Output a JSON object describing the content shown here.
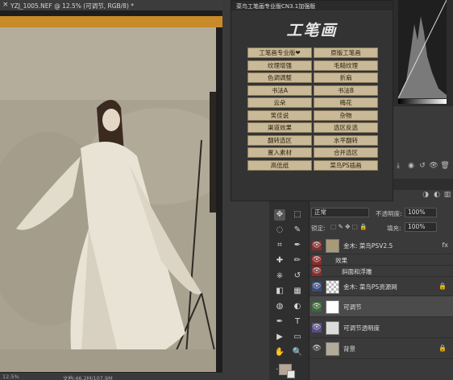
{
  "document": {
    "tab_title": "YZJ_1005.NEF @ 12.5% (可调节, RGB/8) *",
    "close_glyph": "×",
    "status_zoom": "12.5%",
    "status_doc": "文档:46.2M/107.9M"
  },
  "plugin": {
    "title": "菜鸟工笔画专业版CN3.1加强版",
    "logo": "工笔画",
    "buttons": [
      "工笔画专业版❤",
      "原版工笔画",
      "纹理增强",
      "毛糙纹理",
      "色调调整",
      "折扇",
      "书法A",
      "书法B",
      "云朵",
      "梅花",
      "笑佳说",
      "杂物",
      "渠道效果",
      "选区反选",
      "翻转选区",
      "水平翻转",
      "置入素材",
      "合并选区",
      "高低纸",
      "菜鸟PS插画"
    ],
    "accent": "#c9b997"
  },
  "tools": {
    "icons": [
      "move-icon",
      "marquee-icon",
      "lasso-icon",
      "quick-select-icon",
      "crop-icon",
      "eyedropper-icon",
      "healing-icon",
      "brush-icon",
      "stamp-icon",
      "history-brush-icon",
      "eraser-icon",
      "gradient-icon",
      "blur-icon",
      "dodge-icon",
      "pen-icon",
      "type-icon",
      "path-select-icon",
      "shape-icon",
      "hand-icon",
      "zoom-icon",
      "more-icon"
    ],
    "glyphs": [
      "✥",
      "⬚",
      "◌",
      "✎",
      "⌗",
      "✒",
      "✚",
      "✏",
      "⎈",
      "↺",
      "◧",
      "▦",
      "◍",
      "◐",
      "✒",
      "T",
      "▶",
      "▭",
      "✋",
      "🔍",
      "…"
    ]
  },
  "layers": {
    "blend_mode": "正常",
    "opacity_label": "不透明度:",
    "opacity_value": "100%",
    "lock_label": "锁定:",
    "fill_label": "填充:",
    "fill_value": "100%",
    "items": [
      {
        "name": "金木: 菜鸟PSV2.5",
        "thumb_color": "#a89a78",
        "eye_color": "#8a2c2c",
        "fx": "fx"
      },
      {
        "name": "效果",
        "thumb_color": "",
        "eye_color": "#8a2c2c",
        "fx": ""
      },
      {
        "name": "斜面和浮雕",
        "thumb_color": "",
        "eye_color": "#8a2c2c",
        "fx": ""
      },
      {
        "name": "金木: 菜鸟PS资源网",
        "thumb_color": "checker",
        "eye_color": "#3a4a7a",
        "fx": ""
      },
      {
        "name": "可调节",
        "thumb_color": "#ffffff",
        "eye_color": "#3a6a3a",
        "fx": ""
      },
      {
        "name": "可调节透明度",
        "thumb_color": "#dcdcdc",
        "eye_color": "#5a4a8a",
        "fx": ""
      },
      {
        "name": "背景",
        "thumb_color": "#b3ab9a",
        "eye_color": "#3a3a3a",
        "fx": ""
      }
    ]
  },
  "colors": {
    "foreground": "#b8a595",
    "background": "#e8e8e8"
  }
}
